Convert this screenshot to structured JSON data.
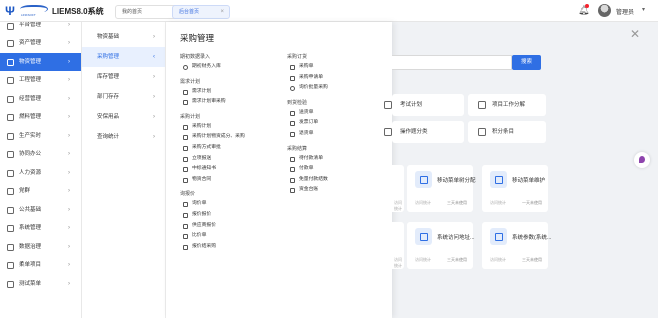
{
  "header": {
    "logo_icon": "menu-fold-icon",
    "brand_sub": "LINKSOFT",
    "title": "LIEMS8.0系统",
    "tabs": [
      {
        "label": "我的首页",
        "active": false
      },
      {
        "label": "后台首页",
        "active": true
      }
    ],
    "user_name": "管理员",
    "accent": "#2f6fe4"
  },
  "sidebar": {
    "items": [
      {
        "label": "平台管理",
        "icon": "settings-icon"
      },
      {
        "label": "资产管理",
        "icon": "asset-icon"
      },
      {
        "label": "物资管理",
        "icon": "box-icon",
        "active": true
      },
      {
        "label": "工程管理",
        "icon": "engineering-icon"
      },
      {
        "label": "经营管理",
        "icon": "business-icon"
      },
      {
        "label": "燃料管理",
        "icon": "fuel-icon"
      },
      {
        "label": "生产实时",
        "icon": "production-icon"
      },
      {
        "label": "协同办公",
        "icon": "office-icon"
      },
      {
        "label": "人力资源",
        "icon": "hr-icon"
      },
      {
        "label": "党群",
        "icon": "party-icon"
      },
      {
        "label": "公共基础",
        "icon": "public-icon"
      },
      {
        "label": "系统管理",
        "icon": "system-icon"
      },
      {
        "label": "数据治理",
        "icon": "data-icon"
      },
      {
        "label": "柔单项目",
        "icon": "project-icon"
      },
      {
        "label": "测试菜单",
        "icon": "test-icon"
      }
    ]
  },
  "submenu": {
    "items": [
      {
        "label": "物资基础"
      },
      {
        "label": "采购管理",
        "active": true
      },
      {
        "label": "库存管理"
      },
      {
        "label": "部门存存"
      },
      {
        "label": "安保用品"
      },
      {
        "label": "查询统计"
      }
    ]
  },
  "panel": {
    "title": "采购管理",
    "col1": [
      {
        "title": "期初数据录入",
        "links": [
          "期初财务入库"
        ]
      },
      {
        "title": "需求计划",
        "links": [
          "需求计划",
          "需求计划审采购"
        ]
      },
      {
        "title": "采购计划",
        "links": [
          "采购计划",
          "采购计划物资成分、采购",
          "采购方式审批",
          "立项报送",
          "中标通知书",
          "物资合同"
        ]
      },
      {
        "title": "询报价",
        "links": [
          "询价单",
          "报价报价",
          "供应商报价",
          "比价单",
          "报价结采购"
        ]
      }
    ],
    "col2": [
      {
        "title": "采购订货",
        "links": [
          "采购单",
          "采购申请单",
          "询价批量采购"
        ]
      },
      {
        "title": "到货检验",
        "links": [
          "送货单",
          "发票订单",
          "退货单"
        ]
      },
      {
        "title": "采购结算",
        "links": [
          "待付款清单",
          "付款单",
          "免量付款结数",
          "资金台账"
        ]
      }
    ]
  },
  "main": {
    "search_button": "搜索",
    "quick": [
      {
        "label": "考试计划",
        "icon": "exam-icon"
      },
      {
        "label": "项目工作分解",
        "icon": "monitor-icon"
      },
      {
        "label": "操作题分类",
        "icon": "folder-icon"
      },
      {
        "label": "积分条目",
        "icon": "points-icon"
      }
    ],
    "tiles": [
      {
        "name": "移动菜单树分配",
        "count": "访问统计",
        "usage": "三天未使用"
      },
      {
        "name": "移动菜单维护",
        "count": "访问统计",
        "usage": "一天未使用"
      },
      {
        "name": "系统访问地址...",
        "count": "访问统计",
        "usage": "三天未使用"
      },
      {
        "name": "系统参数(系统...",
        "count": "访问统计",
        "usage": "三天未使用"
      }
    ],
    "partial_tiles": [
      {
        "count": "访问统计",
        "usage": "三天未使用"
      },
      {
        "count": "访问统计",
        "usage": "三天未使用"
      }
    ]
  }
}
